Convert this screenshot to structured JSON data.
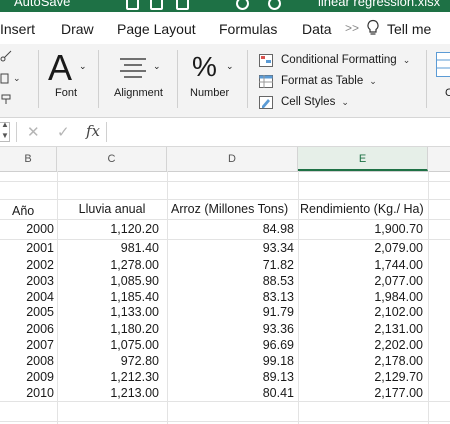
{
  "window": {
    "autosave_label": "AutoSave",
    "file_name": "linear regression.xlsx"
  },
  "tabs": [
    "Insert",
    "Draw",
    "Page Layout",
    "Formulas",
    "Data"
  ],
  "tell_me": "Tell me",
  "ribbon": {
    "font_label": "Font",
    "alignment_label": "Alignment",
    "number_label": "Number",
    "font_glyph": "A",
    "number_glyph": "%",
    "conditional_formatting": "Conditional Formatting",
    "format_as_table": "Format as Table",
    "cell_styles": "Cell Styles",
    "cut_label": "C"
  },
  "formula_bar": {
    "fx": "fx",
    "cancel": "✕",
    "enter": "✓",
    "content": ""
  },
  "columns": [
    "B",
    "C",
    "D",
    "E"
  ],
  "selected_column": "E",
  "table": {
    "headers": [
      "Año",
      "Lluvia anual",
      "Arroz (Millones Tons)",
      "Rendimiento (Kg./ Ha)"
    ],
    "rows": [
      [
        "2000",
        "1,120.20",
        "84.98",
        "1,900.70"
      ],
      [
        "2001",
        "981.40",
        "93.34",
        "2,079.00"
      ],
      [
        "2002",
        "1,278.00",
        "71.82",
        "1,744.00"
      ],
      [
        "2003",
        "1,085.90",
        "88.53",
        "2,077.00"
      ],
      [
        "2004",
        "1,185.40",
        "83.13",
        "1,984.00"
      ],
      [
        "2005",
        "1,133.00",
        "91.79",
        "2,102.00"
      ],
      [
        "2006",
        "1,180.20",
        "93.36",
        "2,131.00"
      ],
      [
        "2007",
        "1,075.00",
        "96.69",
        "2,202.00"
      ],
      [
        "2008",
        "972.80",
        "99.18",
        "2,178.00"
      ],
      [
        "2009",
        "1,212.30",
        "89.13",
        "2,129.70"
      ],
      [
        "2010",
        "1,213.00",
        "80.41",
        "2,177.00"
      ]
    ]
  }
}
